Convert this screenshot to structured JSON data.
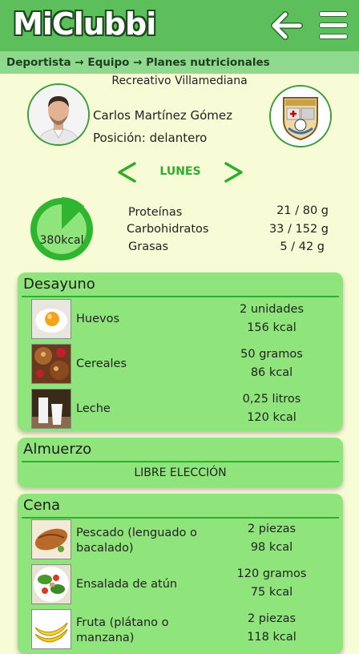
{
  "header": {
    "logo": "MiClubbi",
    "back_icon": "arrow-left-icon",
    "menu_icon": "hamburger-icon"
  },
  "breadcrumb": "Deportista → Equipo → Planes nutricionales",
  "club": "Recreativo Villamediana",
  "player": {
    "name": "Carlos Martínez Gómez",
    "position": "Posición: delantero"
  },
  "day": {
    "label": "LUNES",
    "prev_icon": "chevron-left-icon",
    "next_icon": "chevron-right-icon"
  },
  "summary": {
    "kcal": "380kcal",
    "progress": 0.125,
    "macros": [
      {
        "label": "Proteínas",
        "value": "21 / 80 g"
      },
      {
        "label": "Carbohidratos",
        "value": "33 / 152 g"
      },
      {
        "label": "Grasas",
        "value": "5 / 42 g"
      }
    ]
  },
  "meals": {
    "breakfast": {
      "title": "Desayuno",
      "items": [
        {
          "name": "Huevos",
          "qty": "2 unidades",
          "kcal": "156 kcal"
        },
        {
          "name": "Cereales",
          "qty": "50 gramos",
          "kcal": "86 kcal"
        },
        {
          "name": "Leche",
          "qty": "0,25 litros",
          "kcal": "120 kcal"
        }
      ]
    },
    "lunch": {
      "title": "Almuerzo",
      "note": "LIBRE ELECCIÓN"
    },
    "dinner": {
      "title": "Cena",
      "items": [
        {
          "name": "Pescado (lenguado o bacalado)",
          "qty": "2 piezas",
          "kcal": "98 kcal"
        },
        {
          "name": "Ensalada de atún",
          "qty": "120 gramos",
          "kcal": "75 kcal"
        },
        {
          "name": "Fruta (plátano o manzana)",
          "qty": "2 piezas",
          "kcal": "118 kcal"
        }
      ]
    }
  },
  "colors": {
    "header": "#5cbf5c",
    "breadcrumb": "#8fd98f",
    "card": "#8fe47c",
    "accent": "#2eae2e",
    "background": "#f7fbd6"
  }
}
